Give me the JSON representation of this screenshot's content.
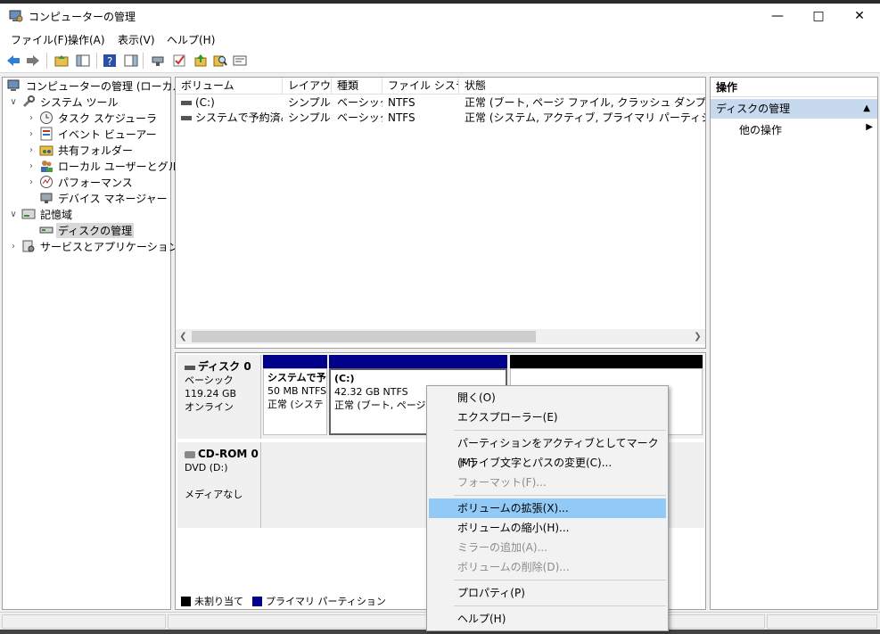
{
  "window": {
    "title": "コンピューターの管理"
  },
  "menu": [
    "ファイル(F)",
    "操作(A)",
    "表示(V)",
    "ヘルプ(H)"
  ],
  "tree": {
    "root": "コンピューターの管理 (ローカル)",
    "system_tools": "システム ツール",
    "task_scheduler": "タスク スケジューラ",
    "event_viewer": "イベント ビューアー",
    "shared_folders": "共有フォルダー",
    "local_users": "ローカル ユーザーとグループ",
    "performance": "パフォーマンス",
    "device_manager": "デバイス マネージャー",
    "storage": "記憶域",
    "disk_management": "ディスクの管理",
    "services_apps": "サービスとアプリケーション"
  },
  "volume_list": {
    "columns": [
      "ボリューム",
      "レイアウト",
      "種類",
      "ファイル システム",
      "状態"
    ],
    "rows": [
      [
        "(C:)",
        "シンプル",
        "ベーシック",
        "NTFS",
        "正常 (ブート, ページ ファイル, クラッシュ ダンプ, プライマリ パー"
      ],
      [
        "システムで予約済み",
        "シンプル",
        "ベーシック",
        "NTFS",
        "正常 (システム, アクティブ, プライマリ パーティション)"
      ]
    ]
  },
  "disks": {
    "disk0": {
      "name": "ディスク 0",
      "type": "ベーシック",
      "size": "119.24 GB",
      "status": "オンライン",
      "part1": {
        "name": "システムで予",
        "size": "50 MB NTFS",
        "status": "正常 (システ"
      },
      "part2": {
        "name": "(C:)",
        "size": "42.32 GB NTFS",
        "status": "正常 (ブート, ページ フ"
      }
    },
    "cdrom0": {
      "name": "CD-ROM 0",
      "drive": "DVD (D:)",
      "status": "メディアなし"
    }
  },
  "legend": {
    "unallocated": "未割り当て",
    "primary": "プライマリ パーティション"
  },
  "actions_pane": {
    "header": "操作",
    "selected": "ディスクの管理",
    "more": "他の操作"
  },
  "context_menu": [
    "開く(O)",
    "エクスプローラー(E)",
    "パーティションをアクティブとしてマーク(M)",
    "ドライブ文字とパスの変更(C)...",
    "フォーマット(F)...",
    "ボリュームの拡張(X)...",
    "ボリュームの縮小(H)...",
    "ミラーの追加(A)...",
    "ボリュームの削除(D)...",
    "プロパティ(P)",
    "ヘルプ(H)"
  ],
  "colors": {
    "primary_partition": "#00008b",
    "unallocated": "#000000",
    "highlight": "#91c9f7"
  }
}
